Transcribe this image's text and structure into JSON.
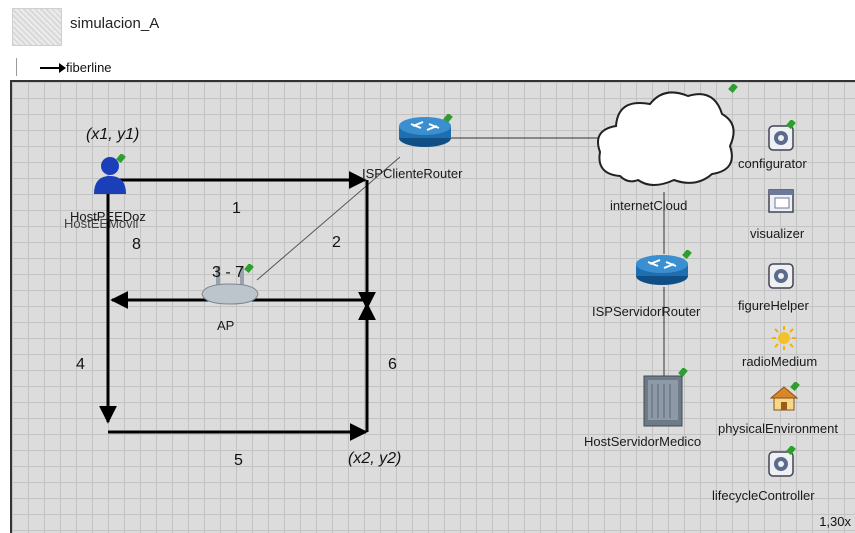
{
  "header": {
    "title": "simulacion_A",
    "legend_label": "fiberline"
  },
  "nodes": {
    "host_label": "HostPEEDoz",
    "host_label_overlap": "HostEEMovil",
    "isp_client": "ISPClienteRouter",
    "internet": "internetCloud",
    "isp_server": "ISPServidorRouter",
    "ap": "AP",
    "host_server": "HostServidorMedico"
  },
  "modules": {
    "configurator": "configurator",
    "visualizer": "visualizer",
    "figure_helper": "figureHelper",
    "radio_medium": "radioMedium",
    "physical_env": "physicalEnvironment",
    "lifecycle": "lifecycleController"
  },
  "annotations": {
    "coord1": "(x1, y1)",
    "coord2": "(x2, y2)",
    "seg1": "1",
    "seg2": "2",
    "seg37": "3 - 7",
    "seg4": "4",
    "seg5": "5",
    "seg6": "6",
    "seg8": "8"
  },
  "zoom": "1,30x",
  "colors": {
    "canvas_bg": "#dcdcdc",
    "grid": "#c3c3c3",
    "router_blue": "#1f6fb0",
    "host_blue": "#1a3fb8"
  }
}
